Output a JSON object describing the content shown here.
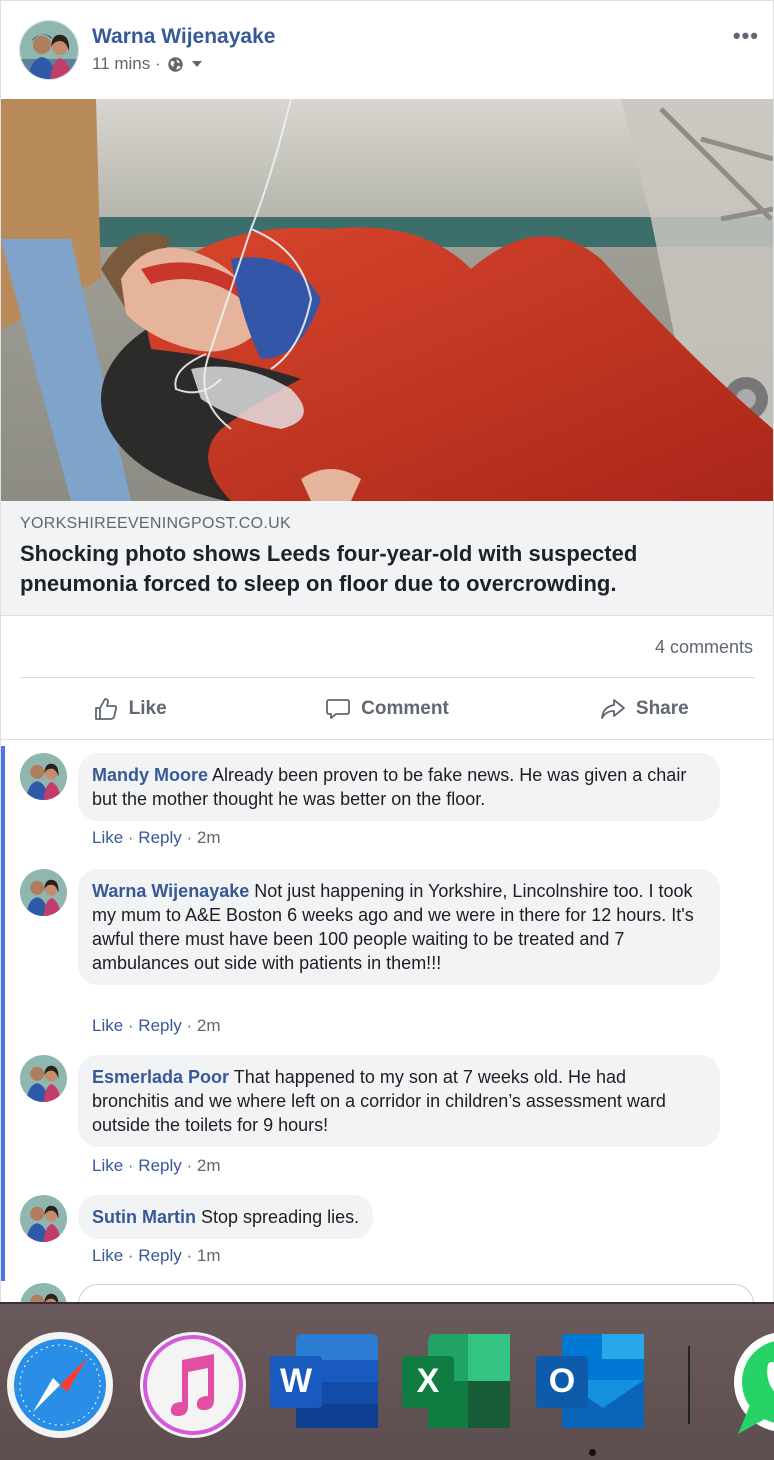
{
  "post": {
    "author": "Warna Wijenayake",
    "time": "11 mins ·",
    "more": "•••",
    "link": {
      "domain": "YORKSHIREEVENINGPOST.CO.UK",
      "title": "Shocking photo shows Leeds four-year-old with suspected pneumonia forced to sleep on floor due to overcrowding."
    },
    "comments_count": "4 comments",
    "actions": {
      "like": "Like",
      "comment": "Comment",
      "share": "Share"
    }
  },
  "comments": [
    {
      "name": "Mandy Moore",
      "text": "Already been proven to be fake news. He was given a chair but the mother thought he was better on the floor.",
      "like": "Like",
      "reply": "Reply",
      "time": "2m"
    },
    {
      "name": "Warna Wijenayake",
      "text": "Not just happening in Yorkshire, Lincolnshire too. I took my mum to A&E Boston 6 weeks ago and we were in there for 12 hours. It's awful there must have been 100 people waiting to be treated and 7 ambulances out side with patients in them!!!",
      "like": "Like",
      "reply": "Reply",
      "time": "2m"
    },
    {
      "name": "Esmerlada Poor",
      "text": "That happened to my son at 7 weeks old. He had bronchitis and we where left on a corridor in children’s assessment ward outside the toilets for 9 hours!",
      "like": "Like",
      "reply": "Reply",
      "time": "2m"
    },
    {
      "name": "Sutin Martin",
      "text": "Stop spreading lies.",
      "like": "Like",
      "reply": "Reply",
      "time": "1m"
    }
  ],
  "dock": {
    "apps": [
      "Safari",
      "iTunes",
      "Word",
      "Excel",
      "Outlook",
      "WhatsApp"
    ],
    "word_letter": "W",
    "excel_letter": "X",
    "outlook_letter": "O"
  },
  "colors": {
    "link": "#385898",
    "accent_bar": "#4a76e8"
  }
}
